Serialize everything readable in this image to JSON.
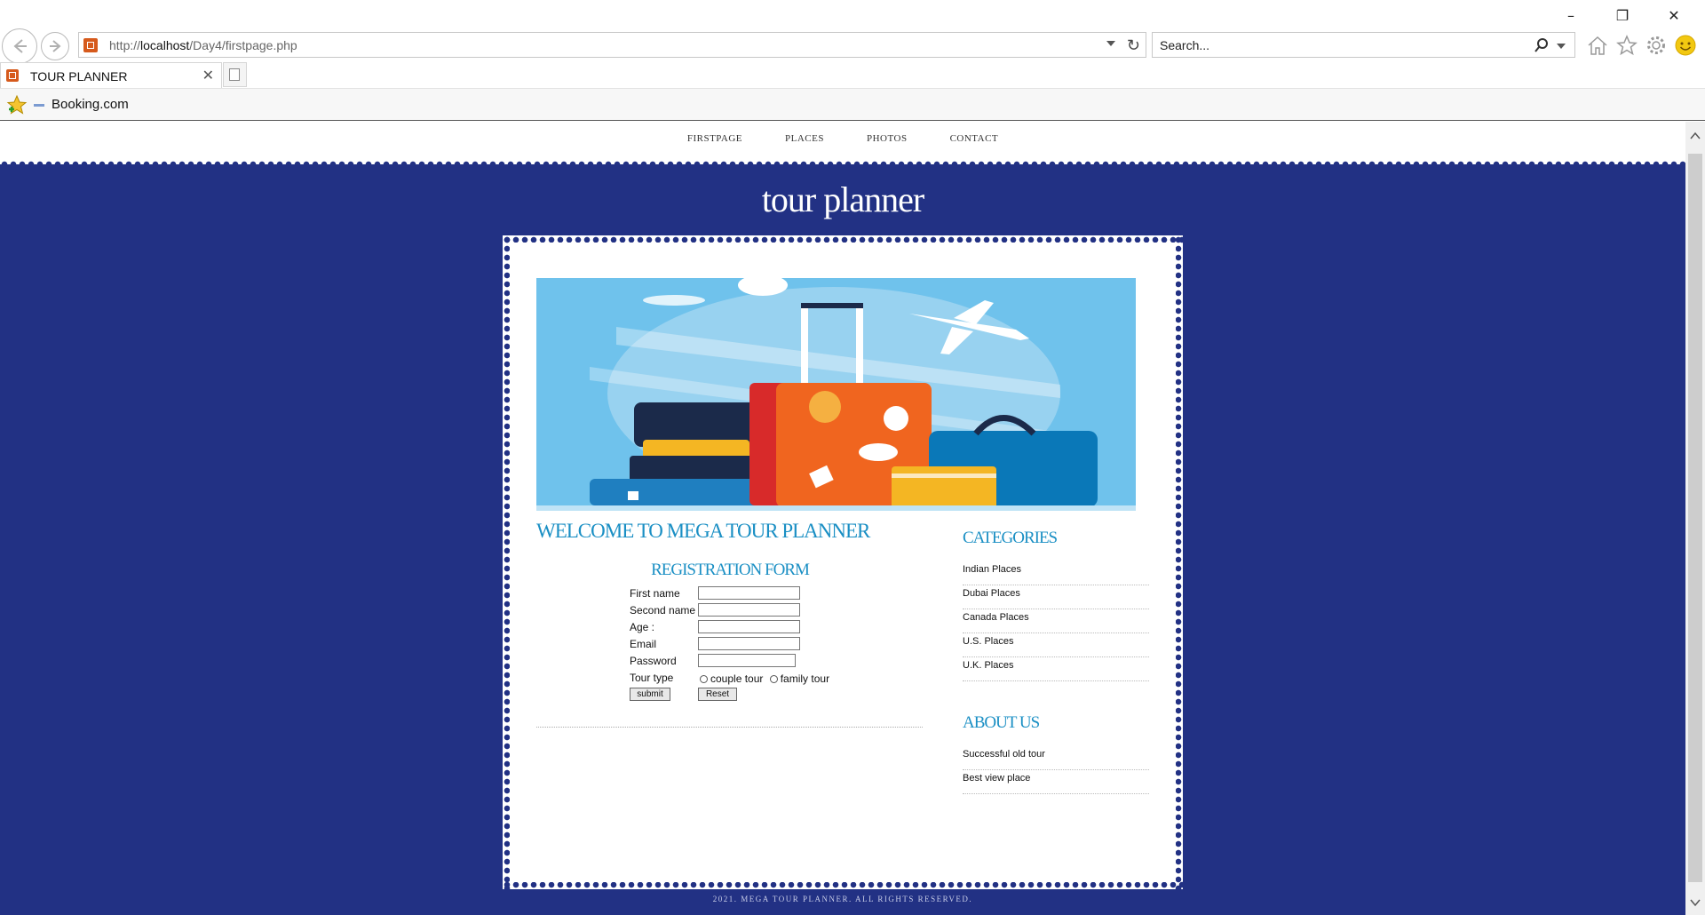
{
  "browser": {
    "url_prefix": "http://",
    "url_host": "localhost",
    "url_path": "/Day4/firstpage.php",
    "search_placeholder": "Search...",
    "tab_title": "TOUR PLANNER",
    "favorites": [
      {
        "label": "Booking.com"
      }
    ],
    "window_controls": [
      "minimize",
      "restore",
      "close"
    ]
  },
  "site": {
    "nav": [
      "FIRSTPAGE",
      "PLACES",
      "PHOTOS",
      "CONTACT"
    ],
    "title": "tour planner",
    "welcome": "WELCOME TO MEGA TOUR PLANNER",
    "form": {
      "title": "REGISTRATION FORM",
      "fields": {
        "first_name": "First name",
        "second_name": "Second name",
        "age": "Age :",
        "email": "Email",
        "password": "Password",
        "tour_type": "Tour type"
      },
      "tour_options": [
        "couple tour",
        "family tour"
      ],
      "submit_label": "submit",
      "reset_label": "Reset"
    },
    "categories": {
      "title": "CATEGORIES",
      "items": [
        "Indian Places",
        "Dubai Places",
        "Canada Places",
        "U.S. Places",
        "U.K. Places"
      ]
    },
    "about": {
      "title": "ABOUT US",
      "items": [
        "Successful old tour",
        "Best view place"
      ]
    },
    "footer": "2021. MEGA TOUR PLANNER. ALL RIGHTS RESERVED."
  },
  "colors": {
    "page_background": "#223184",
    "heading_blue": "#1a8fc4",
    "hero_sky": "#6fc2ec"
  },
  "icons": [
    "back-arrow-icon",
    "forward-arrow-icon",
    "refresh-icon",
    "search-icon",
    "home-icon",
    "favorites-star-icon",
    "settings-gear-icon",
    "smiley-icon"
  ]
}
